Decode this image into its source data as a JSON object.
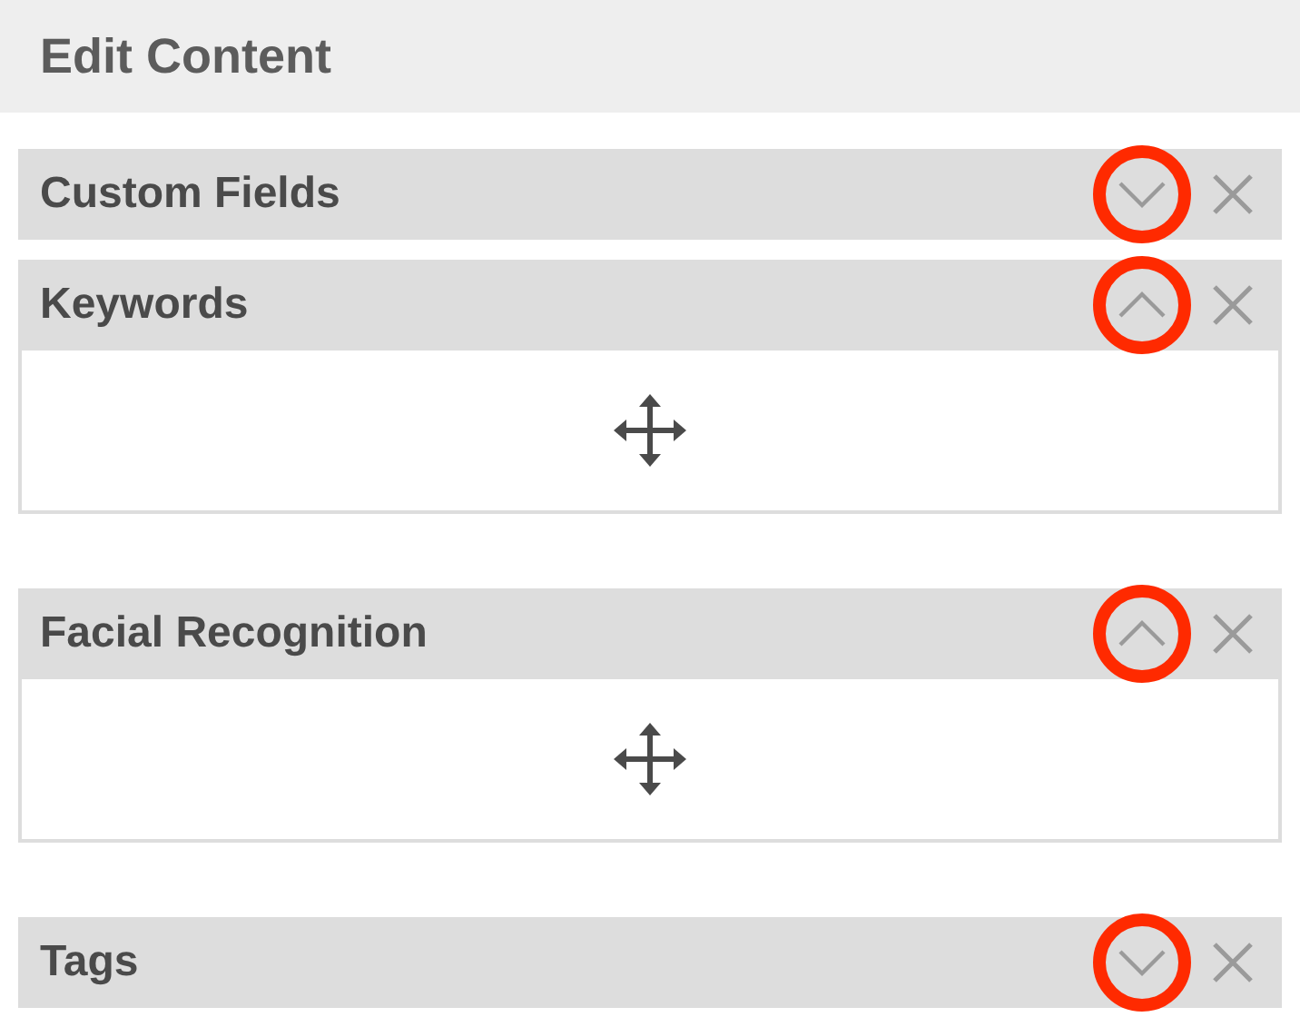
{
  "header": {
    "title": "Edit Content"
  },
  "panels": [
    {
      "title": "Custom Fields",
      "expanded": false,
      "highlighted": true
    },
    {
      "title": "Keywords",
      "expanded": true,
      "highlighted": true
    },
    {
      "title": "Facial Recognition",
      "expanded": true,
      "highlighted": true
    },
    {
      "title": "Tags",
      "expanded": false,
      "highlighted": true
    }
  ]
}
